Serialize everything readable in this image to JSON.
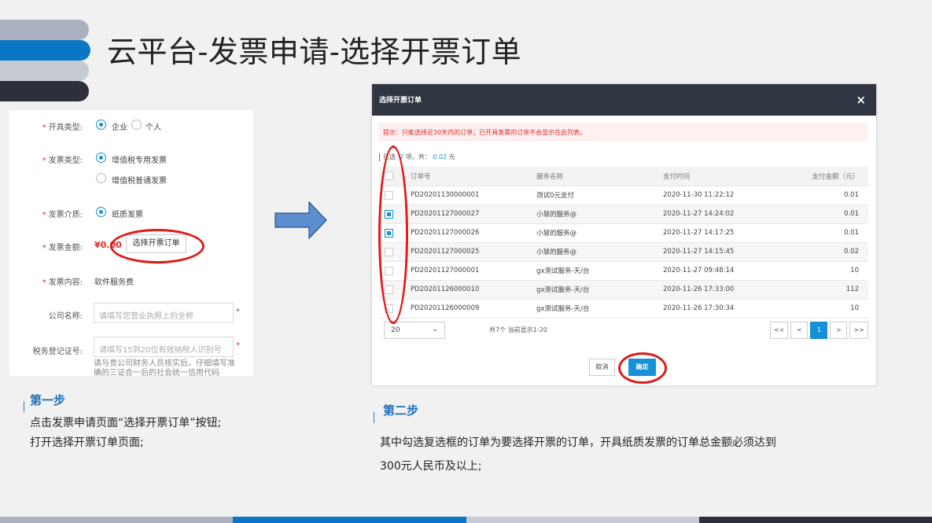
{
  "title": "云平台-发票申请-选择开票订单",
  "form": {
    "invoice_type": {
      "label": "开具类型:",
      "opt1": "企业",
      "opt2": "个人"
    },
    "invoice_kind": {
      "label": "发票类型:",
      "opt1": "增值税专用发票",
      "opt2": "增值税普通发票"
    },
    "medium": {
      "label": "发票介质:",
      "opt1": "纸质发票"
    },
    "amount": {
      "label": "发票金额:",
      "value": "¥0.00",
      "button": "选择开票订单"
    },
    "content": {
      "label": "发票内容:",
      "value": "软件服务费"
    },
    "company": {
      "label": "公司名称:",
      "placeholder": "请填写您营业执照上的全称"
    },
    "tax_id": {
      "label": "税务登记证号:",
      "placeholder": "请填写15到20位有效纳税人识别号",
      "hint": "请与贵公司财务人员核实后，仔细填写准确的三证合一后的社会统一信用代码"
    },
    "required_mark": "*"
  },
  "step1": {
    "title": "第一步",
    "lines": [
      "点击发票申请页面“选择开票订单”按钮;",
      "打开选择开票订单页面;"
    ]
  },
  "step2": {
    "title": "第二步",
    "lines": [
      "其中勾选复选框的订单为要选择开票的订单，开具纸质发票的订单总金额必须达到",
      "300元人民币及以上;"
    ]
  },
  "dialog": {
    "title": "选择开票订单",
    "close": "×",
    "tip": "提示：只能选择近30天内的订单；已开具发票的订单不会显示在此列表。",
    "summary": {
      "prefix": "已选",
      "count": "2",
      "mid": "项，共：",
      "total": "0.02",
      "unit": "元"
    },
    "columns": [
      "订单号",
      "服务名称",
      "支付时间",
      "支付金额（元）"
    ],
    "rows": [
      {
        "id": "PD20201130000001",
        "service": "测试0元支付",
        "time": "2020-11-30 11:22:12",
        "amount": "0.01",
        "checked": false
      },
      {
        "id": "PD20201127000027",
        "service": "小慧的服务@",
        "time": "2020-11-27 14:24:02",
        "amount": "0.01",
        "checked": true
      },
      {
        "id": "PD20201127000026",
        "service": "小慧的服务@",
        "time": "2020-11-27 14:17:25",
        "amount": "0.01",
        "checked": true
      },
      {
        "id": "PD20201127000025",
        "service": "小慧的服务@",
        "time": "2020-11-27 14:15:45",
        "amount": "0.02",
        "checked": false
      },
      {
        "id": "PD20201127000001",
        "service": "gx测试服务-天/台",
        "time": "2020-11-27 09:48:14",
        "amount": "10",
        "checked": false
      },
      {
        "id": "PD20201126000010",
        "service": "gx测试服务-天/台",
        "time": "2020-11-26 17:33:00",
        "amount": "112",
        "checked": false
      },
      {
        "id": "PD20201126000009",
        "service": "gx测试服务-天/台",
        "time": "2020-11-26 17:30:34",
        "amount": "10",
        "checked": false
      }
    ],
    "page_size": "20",
    "page_info": "共7个 当前显示1-20",
    "pager": [
      "<<",
      "<",
      "1",
      ">",
      ">>"
    ],
    "cancel": "取消",
    "confirm": "确定"
  },
  "colors": {
    "accent": "#1890d5",
    "danger": "#e02c2c",
    "dark": "#2f3541"
  }
}
